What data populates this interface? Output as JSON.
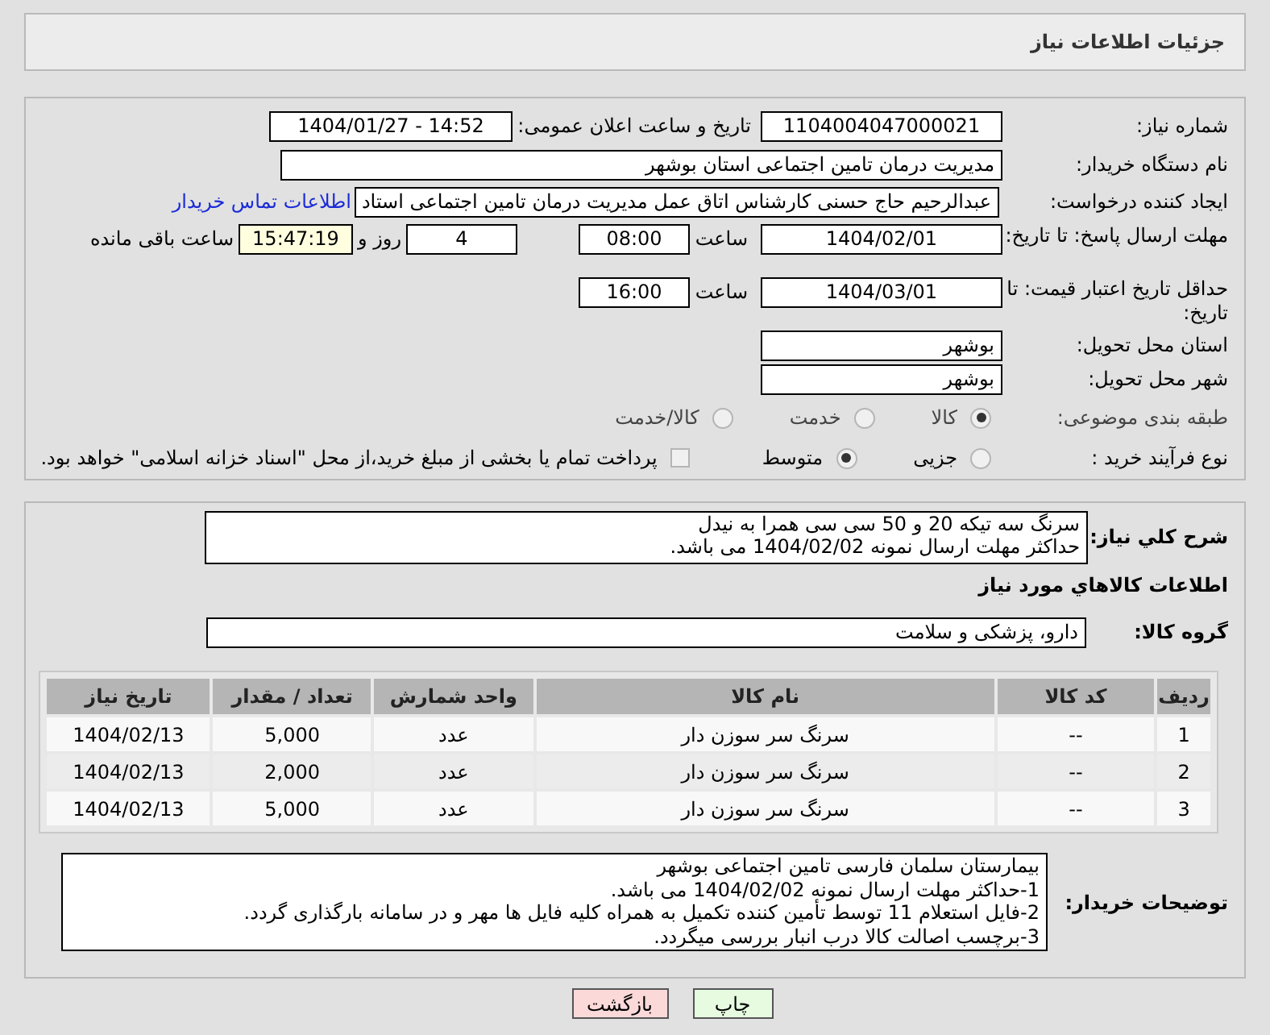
{
  "header": {
    "title": "جزئیات اطلاعات نیاز"
  },
  "need_number": {
    "label": "شماره نیاز:",
    "value": "1104004047000021"
  },
  "announce": {
    "label": "تاریخ و ساعت اعلان عمومی:",
    "value": "1404/01/27 - 14:52"
  },
  "buyer_org": {
    "label": "نام دستگاه خریدار:",
    "value": "مدیریت درمان تامین اجتماعی استان بوشهر"
  },
  "creator": {
    "label": "ایجاد کننده درخواست:",
    "value": "عبدالرحیم حاج حسنی کارشناس اتاق عمل مدیریت درمان تامین اجتماعی استاد",
    "link": "اطلاعات تماس خریدار"
  },
  "deadline": {
    "label": "مهلت ارسال پاسخ: تا تاریخ:",
    "date": "1404/02/01",
    "time_label": "ساعت",
    "time": "08:00",
    "days": "4",
    "days_label": "روز و",
    "remaining": "15:47:19",
    "remaining_label": "ساعت باقی مانده"
  },
  "validity": {
    "label": "حداقل تاریخ اعتبار قیمت: تا تاریخ:",
    "date": "1404/03/01",
    "time_label": "ساعت",
    "time": "16:00"
  },
  "province": {
    "label": "استان محل تحویل:",
    "value": "بوشهر"
  },
  "city": {
    "label": "شهر محل تحویل:",
    "value": "بوشهر"
  },
  "category": {
    "label": "طبقه بندی موضوعی:",
    "options": [
      {
        "label": "کالا",
        "selected": true
      },
      {
        "label": "خدمت",
        "selected": false
      },
      {
        "label": "کالا/خدمت",
        "selected": false
      }
    ]
  },
  "process": {
    "label": "نوع فرآیند خرید :",
    "options": [
      {
        "label": "جزیی",
        "selected": false
      },
      {
        "label": "متوسط",
        "selected": true
      }
    ],
    "treasury": {
      "label": "پرداخت تمام یا بخشی از مبلغ خرید،از محل \"اسناد خزانه اسلامی\" خواهد بود.",
      "checked": false
    }
  },
  "description": {
    "label": "شرح کلي نياز:",
    "lines": [
      "سرنگ سه تیکه 20 و 50 سی سی همرا به نیدل",
      "حداکثر مهلت ارسال نمونه 1404/02/02 می باشد."
    ]
  },
  "goods_title": "اطلاعات کالاهاي مورد نياز",
  "goods_group": {
    "label": "گروه کالا:",
    "value": "دارو، پزشکی و سلامت"
  },
  "table": {
    "columns": [
      "ردیف",
      "کد کالا",
      "نام کالا",
      "واحد شمارش",
      "تعداد / مقدار",
      "تاریخ نیاز"
    ],
    "rows": [
      [
        "1",
        "--",
        "سرنگ سر سوزن دار",
        "عدد",
        "5,000",
        "1404/02/13"
      ],
      [
        "2",
        "--",
        "سرنگ سر سوزن دار",
        "عدد",
        "2,000",
        "1404/02/13"
      ],
      [
        "3",
        "--",
        "سرنگ سر سوزن دار",
        "عدد",
        "5,000",
        "1404/02/13"
      ]
    ]
  },
  "buyer_notes": {
    "label": "توضیحات خریدار:",
    "lines": [
      "بیمارستان سلمان فارسی تامین اجتماعی بوشهر",
      "1-حداکثر مهلت ارسال نمونه 1404/02/02 می باشد.",
      "2-فایل استعلام 11 توسط تأمین کننده تکمیل به همراه کلیه فایل ها مهر و در سامانه بارگذاری گردد.",
      "3-برچسب اصالت کالا درب انبار بررسی میگردد."
    ]
  },
  "buttons": [
    {
      "label": "چاپ",
      "kind": "print"
    },
    {
      "label": "بازگشت",
      "kind": "back"
    }
  ]
}
